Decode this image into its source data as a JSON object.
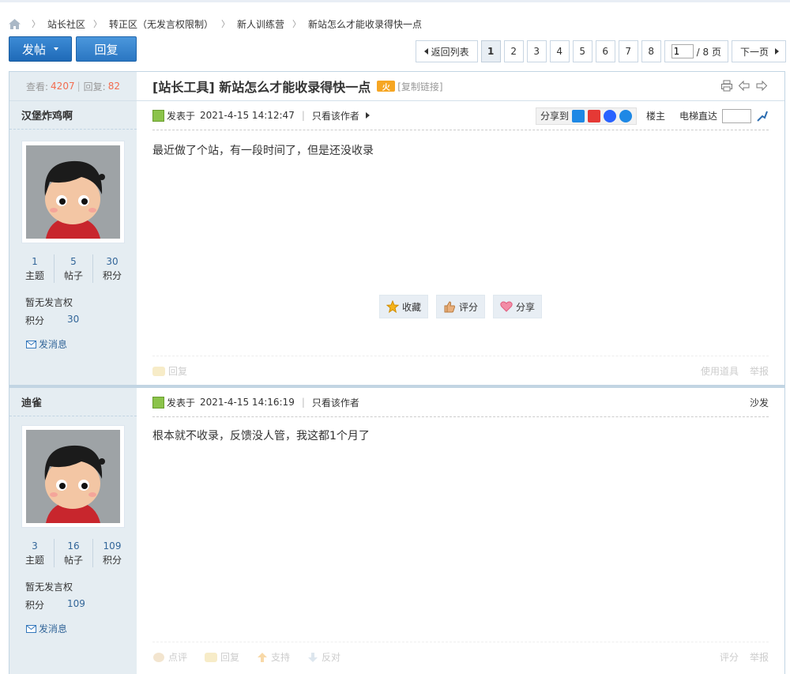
{
  "breadcrumb": {
    "items": [
      "站长社区",
      "转正区（无发言权限制）",
      "新人训练营",
      "新站怎么才能收录得快一点"
    ]
  },
  "toolbar": {
    "post_label": "发帖",
    "reply_label": "回复"
  },
  "pager": {
    "back_label": "返回列表",
    "pages": [
      "1",
      "2",
      "3",
      "4",
      "5",
      "6",
      "7",
      "8"
    ],
    "current": "1",
    "jump_value": "1",
    "total_label": "/ 8 页",
    "next_label": "下一页"
  },
  "thread": {
    "views_label": "查看:",
    "views": "4207",
    "sep": "|",
    "replies_label": "回复:",
    "replies": "82",
    "title": "[站长工具] 新站怎么才能收录得快一点",
    "hot_badge": "火",
    "copy_link": "[复制链接]"
  },
  "posts": [
    {
      "author": "汉堡炸鸡啊",
      "stats": [
        {
          "value": "1",
          "label": "主题"
        },
        {
          "value": "5",
          "label": "帖子"
        },
        {
          "value": "30",
          "label": "积分"
        }
      ],
      "permission": "暂无发言权",
      "score_label": "积分",
      "score": "30",
      "message_label": "发消息",
      "posted_label": "发表于",
      "posted_time": "2021-4-15 14:12:47",
      "author_only": "只看该作者",
      "share_label": "分享到",
      "floor": "楼主",
      "elevator_label": "电梯直达",
      "content": "最近做了个站，有一段时间了，但是还没收录",
      "actions": [
        "收藏",
        "评分",
        "分享"
      ],
      "footer_reply": "回复",
      "footer_tools": "使用道具",
      "footer_report": "举报"
    },
    {
      "author": "迪雀",
      "stats": [
        {
          "value": "3",
          "label": "主题"
        },
        {
          "value": "16",
          "label": "帖子"
        },
        {
          "value": "109",
          "label": "积分"
        }
      ],
      "permission": "暂无发言权",
      "score_label": "积分",
      "score": "109",
      "message_label": "发消息",
      "posted_label": "发表于",
      "posted_time": "2021-4-15 14:16:19",
      "author_only": "只看该作者",
      "floor": "沙发",
      "content": "根本就不收录，反馈没人管，我这都1个月了",
      "footer": [
        "点评",
        "回复",
        "支持",
        "反对"
      ],
      "footer_rate": "评分",
      "footer_report": "举报"
    }
  ],
  "colors": {
    "accent_blue": "#1f6ab8",
    "side_bg": "#e5edf2",
    "count_red": "#f26c4f",
    "link_blue": "#336699"
  }
}
